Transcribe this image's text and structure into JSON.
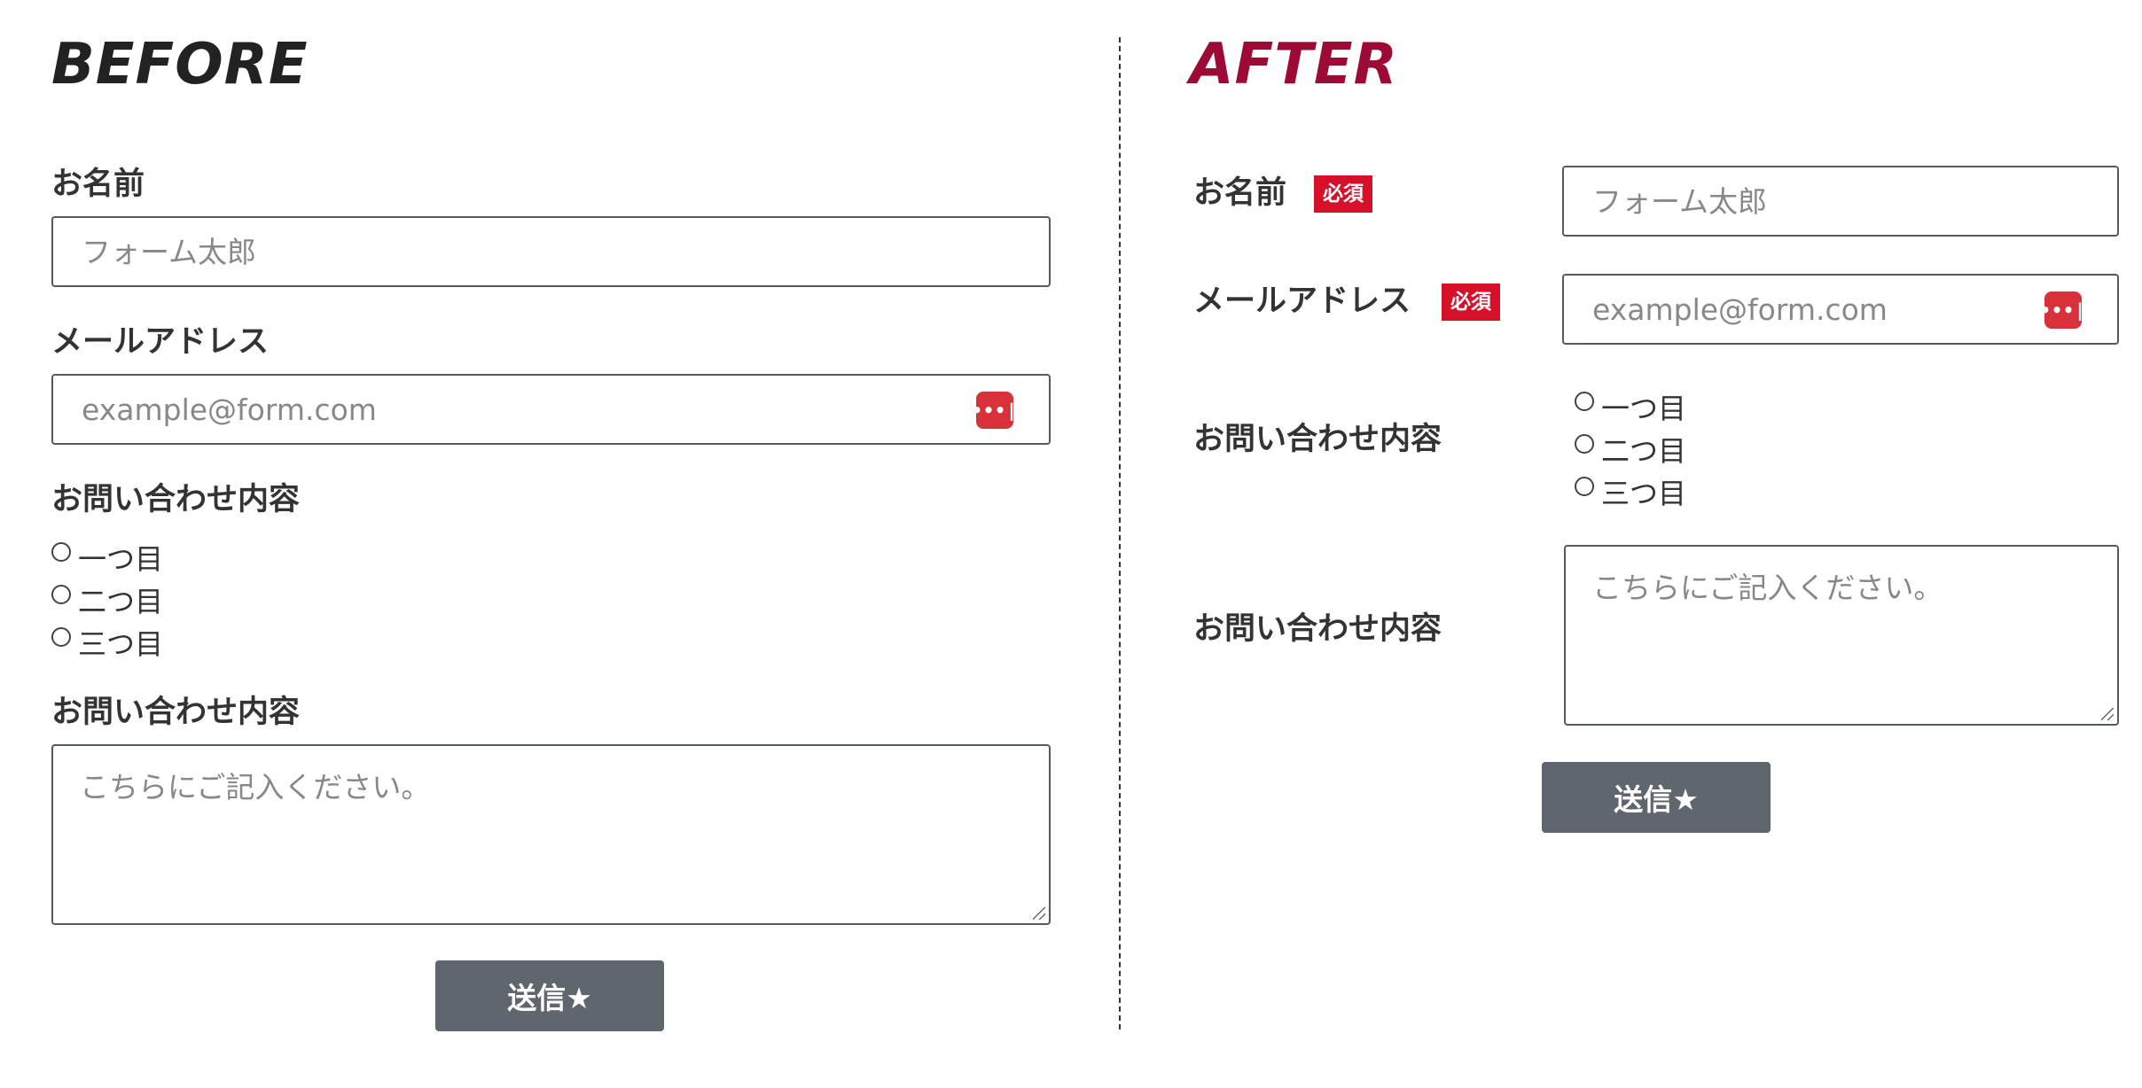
{
  "before": {
    "heading": "BEFORE",
    "name_label": "お名前",
    "name_placeholder": "フォーム太郎",
    "email_label": "メールアドレス",
    "email_placeholder": "example@form.com",
    "radio_label": "お問い合わせ内容",
    "radio_options": [
      "一つ目",
      "二つ目",
      "三つ目"
    ],
    "message_label": "お問い合わせ内容",
    "message_placeholder": "こちらにご記入ください。",
    "submit_label": "送信★"
  },
  "after": {
    "heading": "AFTER",
    "name_label": "お名前",
    "name_required": "必須",
    "name_placeholder": "フォーム太郎",
    "email_label": "メールアドレス",
    "email_required": "必須",
    "email_placeholder": "example@form.com",
    "radio_label": "お問い合わせ内容",
    "radio_options": [
      "一つ目",
      "二つ目",
      "三つ目"
    ],
    "message_label": "お問い合わせ内容",
    "message_placeholder": "こちらにご記入ください。",
    "submit_label": "送信★"
  },
  "password_manager_icon": "password-key-icon",
  "colors": {
    "before_heading": "#222222",
    "after_heading": "#9c0a35",
    "required_badge": "#d7102a",
    "submit_button": "#5f666d",
    "password_icon": "#d7313a"
  }
}
